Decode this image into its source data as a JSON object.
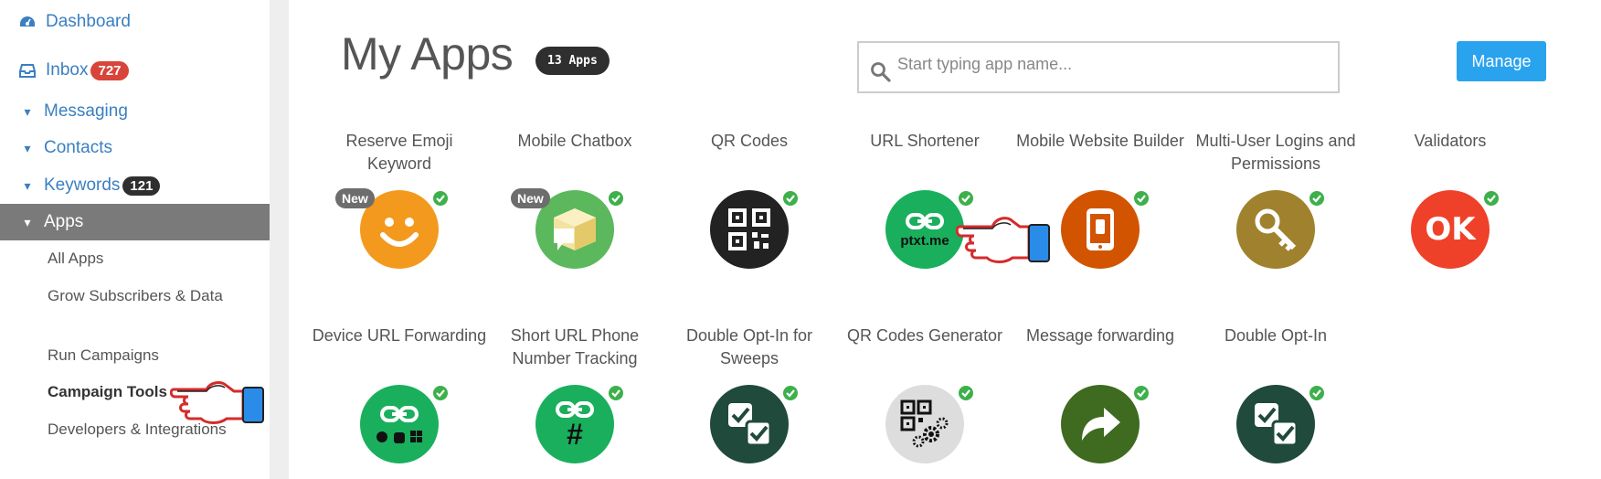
{
  "sidebar": {
    "dashboard": "Dashboard",
    "inbox": {
      "label": "Inbox",
      "badge": "727"
    },
    "messaging": "Messaging",
    "contacts": "Contacts",
    "keywords": {
      "label": "Keywords",
      "badge": "121"
    },
    "apps": "Apps",
    "sub_items": [
      "All Apps",
      "Grow Subscribers & Data",
      "Run Campaigns",
      "Campaign Tools",
      "Developers & Integrations"
    ]
  },
  "main": {
    "title": "My Apps",
    "count_badge": "13 Apps",
    "search_placeholder": "Start typing app name...",
    "manage_label": "Manage",
    "new_label": "New"
  },
  "apps": [
    {
      "name": "Reserve Emoji Keyword",
      "icon": "smiley-icon",
      "color": "#f39a1e",
      "is_new": true
    },
    {
      "name": "Mobile Chatbox",
      "icon": "chatbox-icon",
      "color": "#5cb85c",
      "is_new": true
    },
    {
      "name": "QR Codes",
      "icon": "qr-code-icon",
      "color": "#222222",
      "is_new": false
    },
    {
      "name": "URL Shortener",
      "icon": "link-icon",
      "color": "#1aaf5d",
      "label": "ptxt.me",
      "is_new": false
    },
    {
      "name": "Mobile Website Builder",
      "icon": "phone-icon",
      "color": "#d35400",
      "is_new": false
    },
    {
      "name": "Multi-User Logins and Permissions",
      "icon": "key-icon",
      "color": "#a0812d",
      "is_new": false
    },
    {
      "name": "Validators",
      "icon": "ok-icon",
      "color": "#ef4129",
      "label": "OK",
      "is_new": false
    },
    {
      "name": "Device URL Forwarding",
      "icon": "device-link-icon",
      "color": "#1aaf5d",
      "is_new": false
    },
    {
      "name": "Short URL Phone Number Tracking",
      "icon": "link-hash-icon",
      "color": "#1aaf5d",
      "label": "#",
      "is_new": false
    },
    {
      "name": "Double Opt-In for Sweeps",
      "icon": "double-check-icon",
      "color": "#1f4a3c",
      "is_new": false
    },
    {
      "name": "QR Codes Generator",
      "icon": "qr-gear-icon",
      "color": "#dddddd",
      "is_new": false
    },
    {
      "name": "Message forwarding",
      "icon": "forward-arrow-icon",
      "color": "#3e6b1f",
      "is_new": false
    },
    {
      "name": "Double Opt-In",
      "icon": "double-check-icon",
      "color": "#1f4a3c",
      "is_new": false
    }
  ]
}
